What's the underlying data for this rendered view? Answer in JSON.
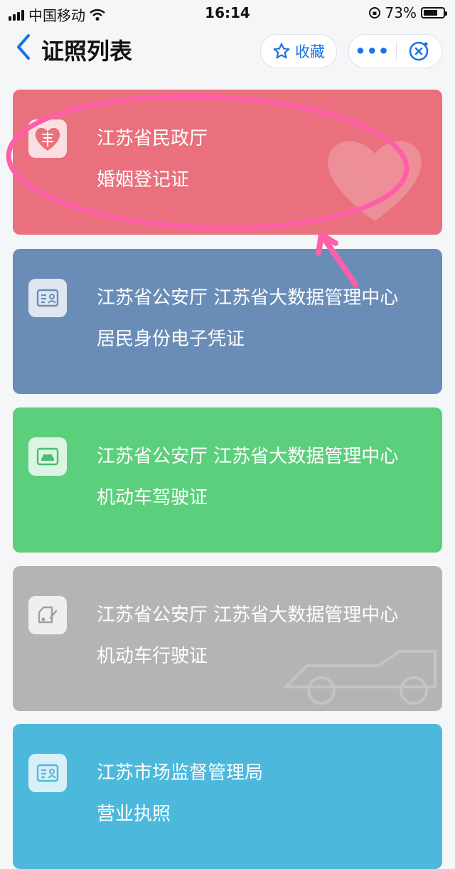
{
  "status_bar": {
    "carrier": "中国移动",
    "time": "16:14",
    "battery": "73%",
    "battery_level": 0.73
  },
  "nav": {
    "title": "证照列表",
    "favorite_label": "收藏",
    "more_label": "•••"
  },
  "cards": [
    {
      "issuer": "江苏省民政厅",
      "cert": "婚姻登记证",
      "color": "#e9707c",
      "icon": "double-happiness-icon"
    },
    {
      "issuer": "江苏省公安厅 江苏省大数据管理中心",
      "cert": "居民身份电子凭证",
      "color": "#6a8db8",
      "icon": "id-card-icon"
    },
    {
      "issuer": "江苏省公安厅 江苏省大数据管理中心",
      "cert": "机动车驾驶证",
      "color": "#5ccf7c",
      "icon": "driver-license-icon"
    },
    {
      "issuer": "江苏省公安厅 江苏省大数据管理中心",
      "cert": "机动车行驶证",
      "color": "#b4b4b4",
      "icon": "vehicle-license-icon"
    },
    {
      "issuer": "江苏市场监督管理局",
      "cert": "营业执照",
      "color": "#4cb8dc",
      "icon": "business-license-icon"
    }
  ],
  "colors": {
    "accent": "#1a73e8",
    "annotation": "#ff5fa8"
  }
}
